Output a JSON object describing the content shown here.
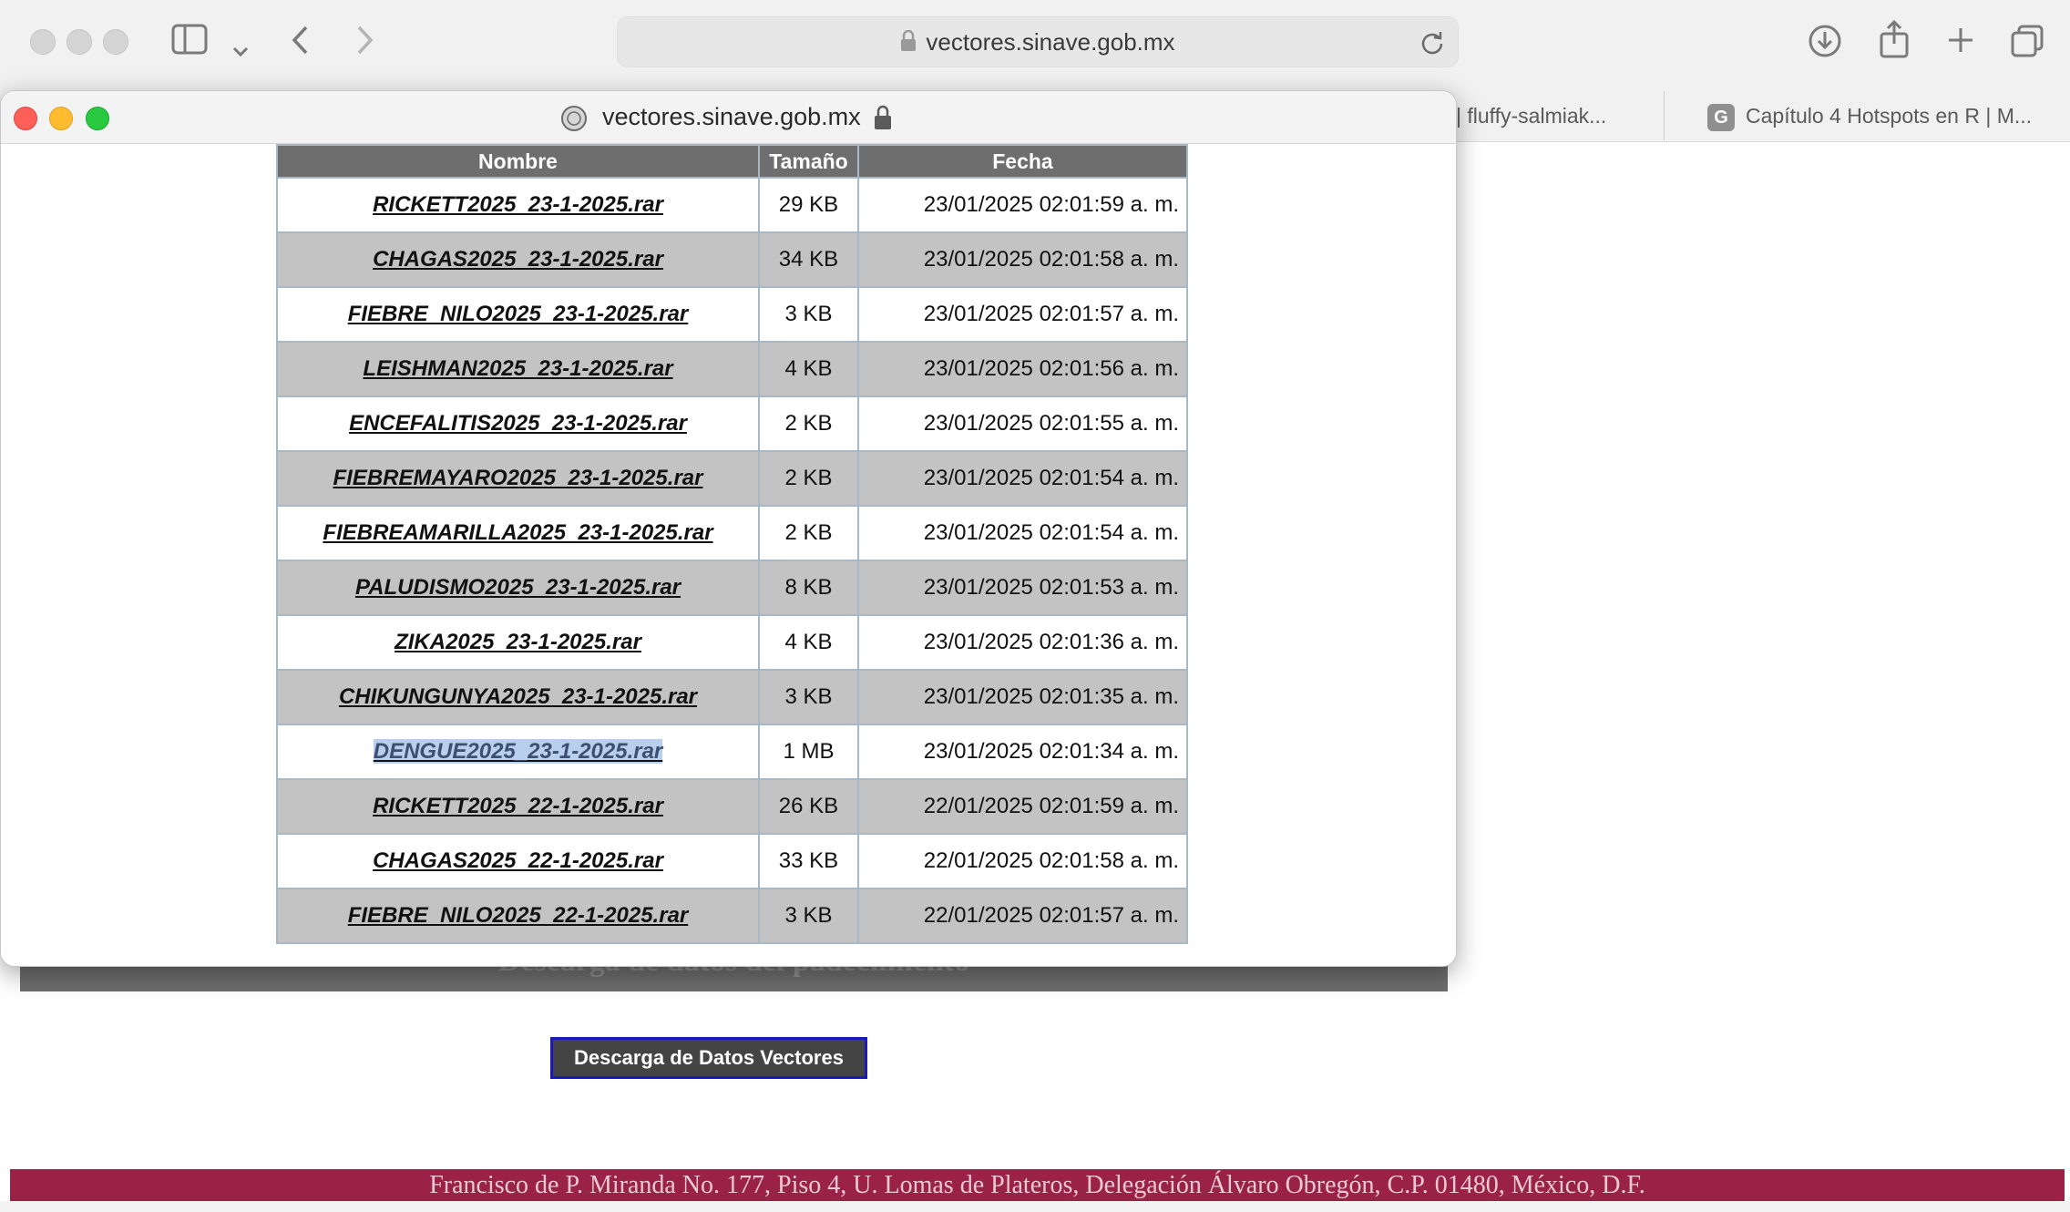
{
  "browser": {
    "address": "vectores.sinave.gob.mx",
    "tabs": [
      {
        "label": "| fluffy-salmiak..."
      },
      {
        "label": "Capítulo 4 Hotspots en R | M...",
        "badge": "G"
      }
    ]
  },
  "popup": {
    "title": "vectores.sinave.gob.mx"
  },
  "table": {
    "headers": {
      "name": "Nombre",
      "size": "Tamaño",
      "date": "Fecha"
    },
    "rows": [
      {
        "name": "RICKETT2025_23-1-2025.rar",
        "size": "29 KB",
        "date": "23/01/2025 02:01:59 a. m."
      },
      {
        "name": "CHAGAS2025_23-1-2025.rar",
        "size": "34 KB",
        "date": "23/01/2025 02:01:58 a. m."
      },
      {
        "name": "FIEBRE_NILO2025_23-1-2025.rar",
        "size": "3 KB",
        "date": "23/01/2025 02:01:57 a. m."
      },
      {
        "name": "LEISHMAN2025_23-1-2025.rar",
        "size": "4 KB",
        "date": "23/01/2025 02:01:56 a. m."
      },
      {
        "name": "ENCEFALITIS2025_23-1-2025.rar",
        "size": "2 KB",
        "date": "23/01/2025 02:01:55 a. m."
      },
      {
        "name": "FIEBREMAYARO2025_23-1-2025.rar",
        "size": "2 KB",
        "date": "23/01/2025 02:01:54 a. m."
      },
      {
        "name": "FIEBREAMARILLA2025_23-1-2025.rar",
        "size": "2 KB",
        "date": "23/01/2025 02:01:54 a. m."
      },
      {
        "name": "PALUDISMO2025_23-1-2025.rar",
        "size": "8 KB",
        "date": "23/01/2025 02:01:53 a. m."
      },
      {
        "name": "ZIKA2025_23-1-2025.rar",
        "size": "4 KB",
        "date": "23/01/2025 02:01:36 a. m."
      },
      {
        "name": "CHIKUNGUNYA2025_23-1-2025.rar",
        "size": "3 KB",
        "date": "23/01/2025 02:01:35 a. m."
      },
      {
        "name": "DENGUE2025_23-1-2025.rar",
        "size": "1 MB",
        "date": "23/01/2025 02:01:34 a. m.",
        "selected": true
      },
      {
        "name": "RICKETT2025_22-1-2025.rar",
        "size": "26 KB",
        "date": "22/01/2025 02:01:59 a. m."
      },
      {
        "name": "CHAGAS2025_22-1-2025.rar",
        "size": "33 KB",
        "date": "22/01/2025 02:01:58 a. m."
      },
      {
        "name": "FIEBRE_NILO2025_22-1-2025.rar",
        "size": "3 KB",
        "date": "22/01/2025 02:01:57 a. m."
      }
    ]
  },
  "page": {
    "banner_text": "Descarga de datos del padecimiento",
    "download_button": "Descarga de Datos Vectores",
    "footer": "Francisco de P. Miranda No. 177, Piso 4, U. Lomas de Plateros, Delegación Álvaro Obregón, C.P. 01480, México, D.F."
  },
  "colors": {
    "footer_bg": "#9b2247",
    "header_bg": "#6e6e6e",
    "row_alt": "#c3c3c3",
    "selection": "#b8d0ee",
    "button_border": "#1a1ab8"
  },
  "icons": [
    "sidebar-icon",
    "chevron-down-icon",
    "back-icon",
    "forward-icon",
    "lock-icon",
    "reload-icon",
    "download-icon",
    "share-icon",
    "new-tab-icon",
    "tabs-overview-icon"
  ]
}
